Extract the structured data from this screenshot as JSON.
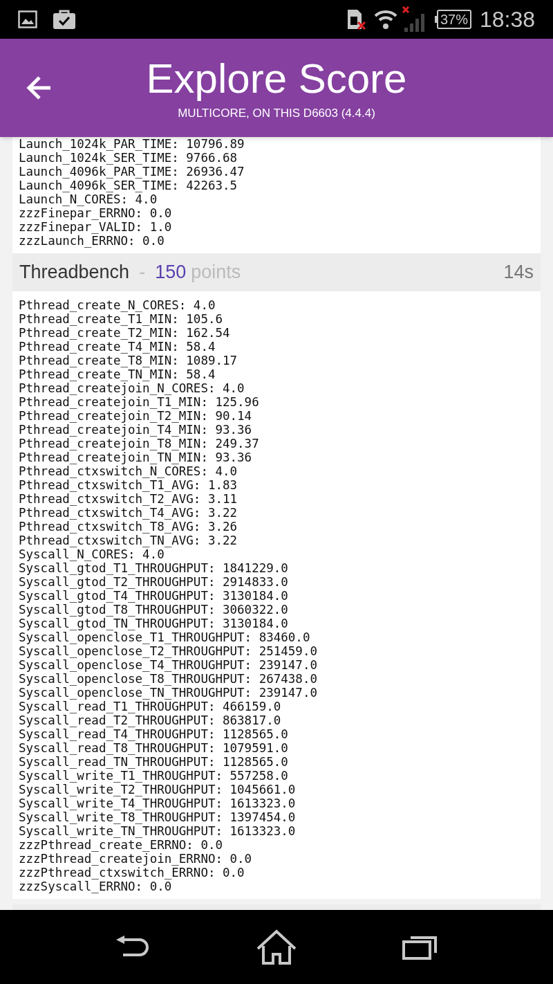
{
  "status_bar": {
    "battery": "37%",
    "time": "18:38"
  },
  "header": {
    "title": "Explore Score",
    "subtitle": "MULTICORE, ON THIS D6603 (4.4.4)"
  },
  "sections": [
    {
      "lines": [
        "Launch_1024k_PAR_TIME: 10796.89",
        "Launch_1024k_SER_TIME: 9766.68",
        "Launch_4096k_PAR_TIME: 26936.47",
        "Launch_4096k_SER_TIME: 42263.5",
        "Launch_N_CORES: 4.0",
        "zzzFinepar_ERRNO: 0.0",
        "zzzFinepar_VALID: 1.0",
        "zzzLaunch_ERRNO: 0.0"
      ]
    },
    {
      "name": "Threadbench",
      "separator": "-",
      "points": "150",
      "points_label": "points",
      "duration": "14s",
      "lines": [
        "Pthread_create_N_CORES: 4.0",
        "Pthread_create_T1_MIN: 105.6",
        "Pthread_create_T2_MIN: 162.54",
        "Pthread_create_T4_MIN: 58.4",
        "Pthread_create_T8_MIN: 1089.17",
        "Pthread_create_TN_MIN: 58.4",
        "Pthread_createjoin_N_CORES: 4.0",
        "Pthread_createjoin_T1_MIN: 125.96",
        "Pthread_createjoin_T2_MIN: 90.14",
        "Pthread_createjoin_T4_MIN: 93.36",
        "Pthread_createjoin_T8_MIN: 249.37",
        "Pthread_createjoin_TN_MIN: 93.36",
        "Pthread_ctxswitch_N_CORES: 4.0",
        "Pthread_ctxswitch_T1_AVG: 1.83",
        "Pthread_ctxswitch_T2_AVG: 3.11",
        "Pthread_ctxswitch_T4_AVG: 3.22",
        "Pthread_ctxswitch_T8_AVG: 3.26",
        "Pthread_ctxswitch_TN_AVG: 3.22",
        "Syscall_N_CORES: 4.0",
        "Syscall_gtod_T1_THROUGHPUT: 1841229.0",
        "Syscall_gtod_T2_THROUGHPUT: 2914833.0",
        "Syscall_gtod_T4_THROUGHPUT: 3130184.0",
        "Syscall_gtod_T8_THROUGHPUT: 3060322.0",
        "Syscall_gtod_TN_THROUGHPUT: 3130184.0",
        "Syscall_openclose_T1_THROUGHPUT: 83460.0",
        "Syscall_openclose_T2_THROUGHPUT: 251459.0",
        "Syscall_openclose_T4_THROUGHPUT: 239147.0",
        "Syscall_openclose_T8_THROUGHPUT: 267438.0",
        "Syscall_openclose_TN_THROUGHPUT: 239147.0",
        "Syscall_read_T1_THROUGHPUT: 466159.0",
        "Syscall_read_T2_THROUGHPUT: 863817.0",
        "Syscall_read_T4_THROUGHPUT: 1128565.0",
        "Syscall_read_T8_THROUGHPUT: 1079591.0",
        "Syscall_read_TN_THROUGHPUT: 1128565.0",
        "Syscall_write_T1_THROUGHPUT: 557258.0",
        "Syscall_write_T2_THROUGHPUT: 1045661.0",
        "Syscall_write_T4_THROUGHPUT: 1613323.0",
        "Syscall_write_T8_THROUGHPUT: 1397454.0",
        "Syscall_write_TN_THROUGHPUT: 1613323.0",
        "zzzPthread_create_ERRNO: 0.0",
        "zzzPthread_createjoin_ERRNO: 0.0",
        "zzzPthread_ctxswitch_ERRNO: 0.0",
        "zzzSyscall_ERRNO: 0.0"
      ]
    }
  ]
}
